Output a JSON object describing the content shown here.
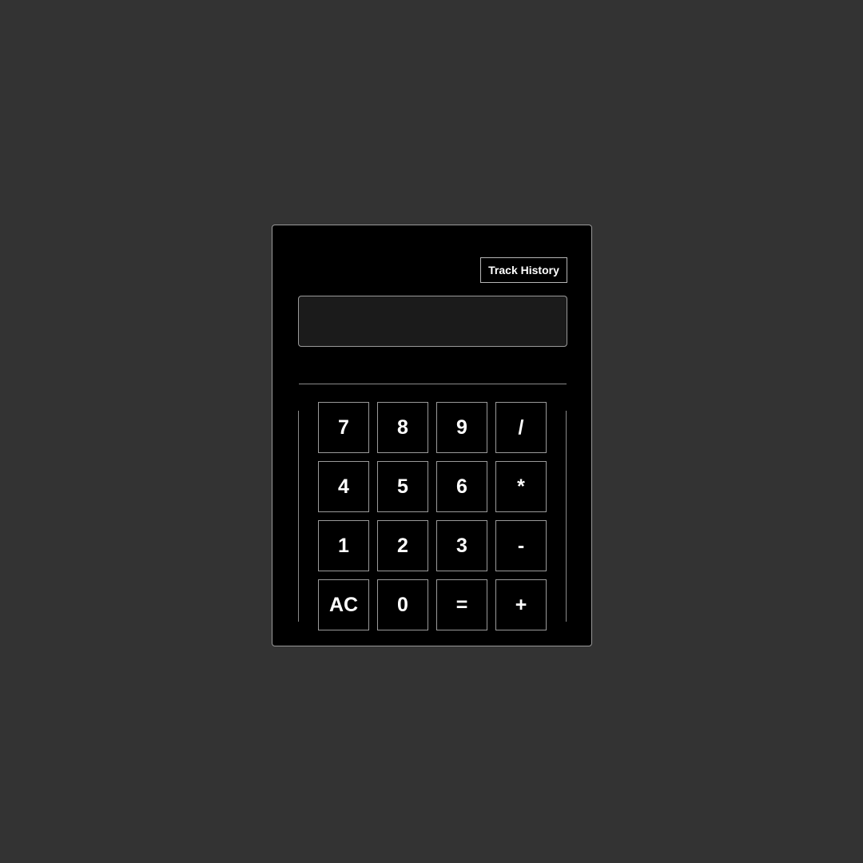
{
  "toolbar": {
    "track_history_label": "Track History"
  },
  "display": {
    "value": ""
  },
  "keypad": {
    "keys": [
      {
        "label": "7",
        "name": "key-7"
      },
      {
        "label": "8",
        "name": "key-8"
      },
      {
        "label": "9",
        "name": "key-9"
      },
      {
        "label": "/",
        "name": "key-divide"
      },
      {
        "label": "4",
        "name": "key-4"
      },
      {
        "label": "5",
        "name": "key-5"
      },
      {
        "label": "6",
        "name": "key-6"
      },
      {
        "label": "*",
        "name": "key-multiply"
      },
      {
        "label": "1",
        "name": "key-1"
      },
      {
        "label": "2",
        "name": "key-2"
      },
      {
        "label": "3",
        "name": "key-3"
      },
      {
        "label": "-",
        "name": "key-subtract"
      },
      {
        "label": "AC",
        "name": "key-all-clear"
      },
      {
        "label": "0",
        "name": "key-0"
      },
      {
        "label": "=",
        "name": "key-equals"
      },
      {
        "label": "+",
        "name": "key-add"
      }
    ]
  },
  "colors": {
    "page_background": "#333333",
    "calculator_background": "#000000",
    "display_background": "#1b1b1b",
    "border": "#9a9a9a",
    "text": "#ffffff"
  }
}
